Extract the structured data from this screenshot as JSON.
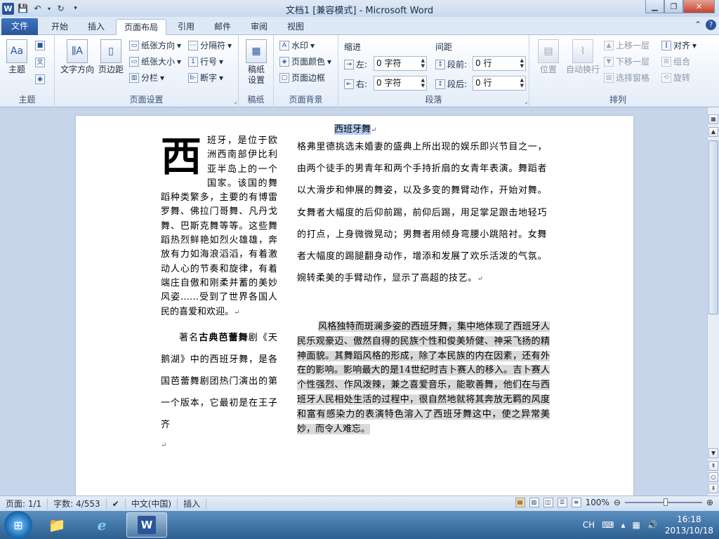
{
  "window": {
    "title": "文档1 [兼容模式] - Microsoft Word",
    "minimize_icon": "minimize-icon",
    "maximize_icon": "restore-icon",
    "close_icon": "close-icon"
  },
  "quick_access": {
    "items": [
      "word-logo-icon",
      "save-icon",
      "undo-icon",
      "redo-icon",
      "customize-icon"
    ]
  },
  "tabs": [
    {
      "label": "文件"
    },
    {
      "label": "开始"
    },
    {
      "label": "插入"
    },
    {
      "label": "页面布局"
    },
    {
      "label": "引用"
    },
    {
      "label": "邮件"
    },
    {
      "label": "审阅"
    },
    {
      "label": "视图"
    }
  ],
  "ribbon": {
    "theme": {
      "group": "主题",
      "theme_btn": "主题",
      "color_btn": "■",
      "font_btn": "文",
      "effect_btn": "◉"
    },
    "page_setup": {
      "group": "页面设置",
      "text_direction": "文字方向",
      "margins": "页边距",
      "orientation": "纸张方向",
      "size": "纸张大小",
      "columns": "分栏",
      "breaks": "分隔符",
      "line_numbers": "行号",
      "hyphenation": "断字"
    },
    "draft": {
      "group": "稿纸",
      "draft_setup": "稿纸\n设置",
      "draft_line1": "稿纸",
      "draft_line2": "设置"
    },
    "page_bg": {
      "group": "页面背景",
      "watermark": "水印",
      "page_color": "页面颜色",
      "page_border": "页面边框"
    },
    "paragraph": {
      "group": "段落",
      "indent_label": "缩进",
      "spacing_label": "间距",
      "left_label": "左:",
      "left_value": "0 字符",
      "right_label": "右:",
      "right_value": "0 字符",
      "before_label": "段前:",
      "before_value": "0 行",
      "after_label": "段后:",
      "after_value": "0 行"
    },
    "arrange": {
      "group": "排列",
      "position": "位置",
      "wrap": "自动换行",
      "bring_forward": "上移一层",
      "send_backward": "下移一层",
      "selection_pane": "选择窗格",
      "align": "对齐",
      "group_btn": "组合",
      "rotate": "旋转"
    }
  },
  "document": {
    "title": "西班牙舞",
    "drop_cap": "西",
    "col1_p1": "班牙，是位于欧洲西南部伊比利亚半岛上的一个国家。该国的舞蹈种类繁多，主要的有博雷罗舞、佛拉门哥舞、凡丹戈舞、巴斯克舞等等。这些舞蹈热烈鲜艳如烈火雄雄，奔放有力如海浪滔滔，有着激动人心的节奏和旋律，有着端庄自傲和刚柔并蓄的美妙风姿……受到了世界各国人民的喜爱和欢迎。",
    "col1_p2_a": "著名",
    "col1_p2_bold": "古典芭蕾舞",
    "col1_p2_b": "剧《天鹅湖》中的西班牙舞，是各国芭蕾舞剧团热门演出的第一个版本，它最初是在王子齐",
    "col2_p3": "格弗里德挑选未婚妻的盛典上所出现的娱乐即兴节目之一，由两个徒手的男青年和两个手持折扇的女青年表演。舞蹈者以大滑步和伸展的舞姿，以及多变的舞臂动作，开始对舞。女舞者大幅度的后仰前踢，前仰后踢，用足掌足跟击地轻巧的打点，上身微微晃动；男舞者用倾身弯腰小跳陪衬。女舞者大幅度的踢腿翻身动作，增添和发展了欢乐活泼的气氛。婉转柔美的手臂动作，显示了高超的技艺。",
    "col2_p4": "风格独特而斑澜多姿的西班牙舞，集中地体现了西班牙人民乐观豪迈、傲然自得的民族个性和俊美矫健、神采飞扬的精神面貌。其舞蹈风格的形成，除了本民族的内在因素，还有外在的影响。影响最大的是14世纪时吉卜赛人的移入。吉卜赛人个性强烈、作风泼辣，兼之喜爱音乐，能歌善舞，他们在与西班牙人民相处生活的过程中，很自然地就将其奔放无羁的风度和富有感染力的表演特色溶入了西班牙舞这中，使之异常美妙，而令人难忘。",
    "para_mark": "↵"
  },
  "statusbar": {
    "page": "页面: 1/1",
    "words": "字数: 4/553",
    "language": "中文(中国)",
    "mode": "插入",
    "zoom": "100%",
    "zoom_fraction": 0.53
  },
  "taskbar": {
    "items": [
      "start-orb-icon",
      "file-explorer-icon",
      "internet-explorer-icon",
      "word-app-icon"
    ],
    "lang": "CH",
    "time": "16:18",
    "date": "2013/10/18"
  }
}
